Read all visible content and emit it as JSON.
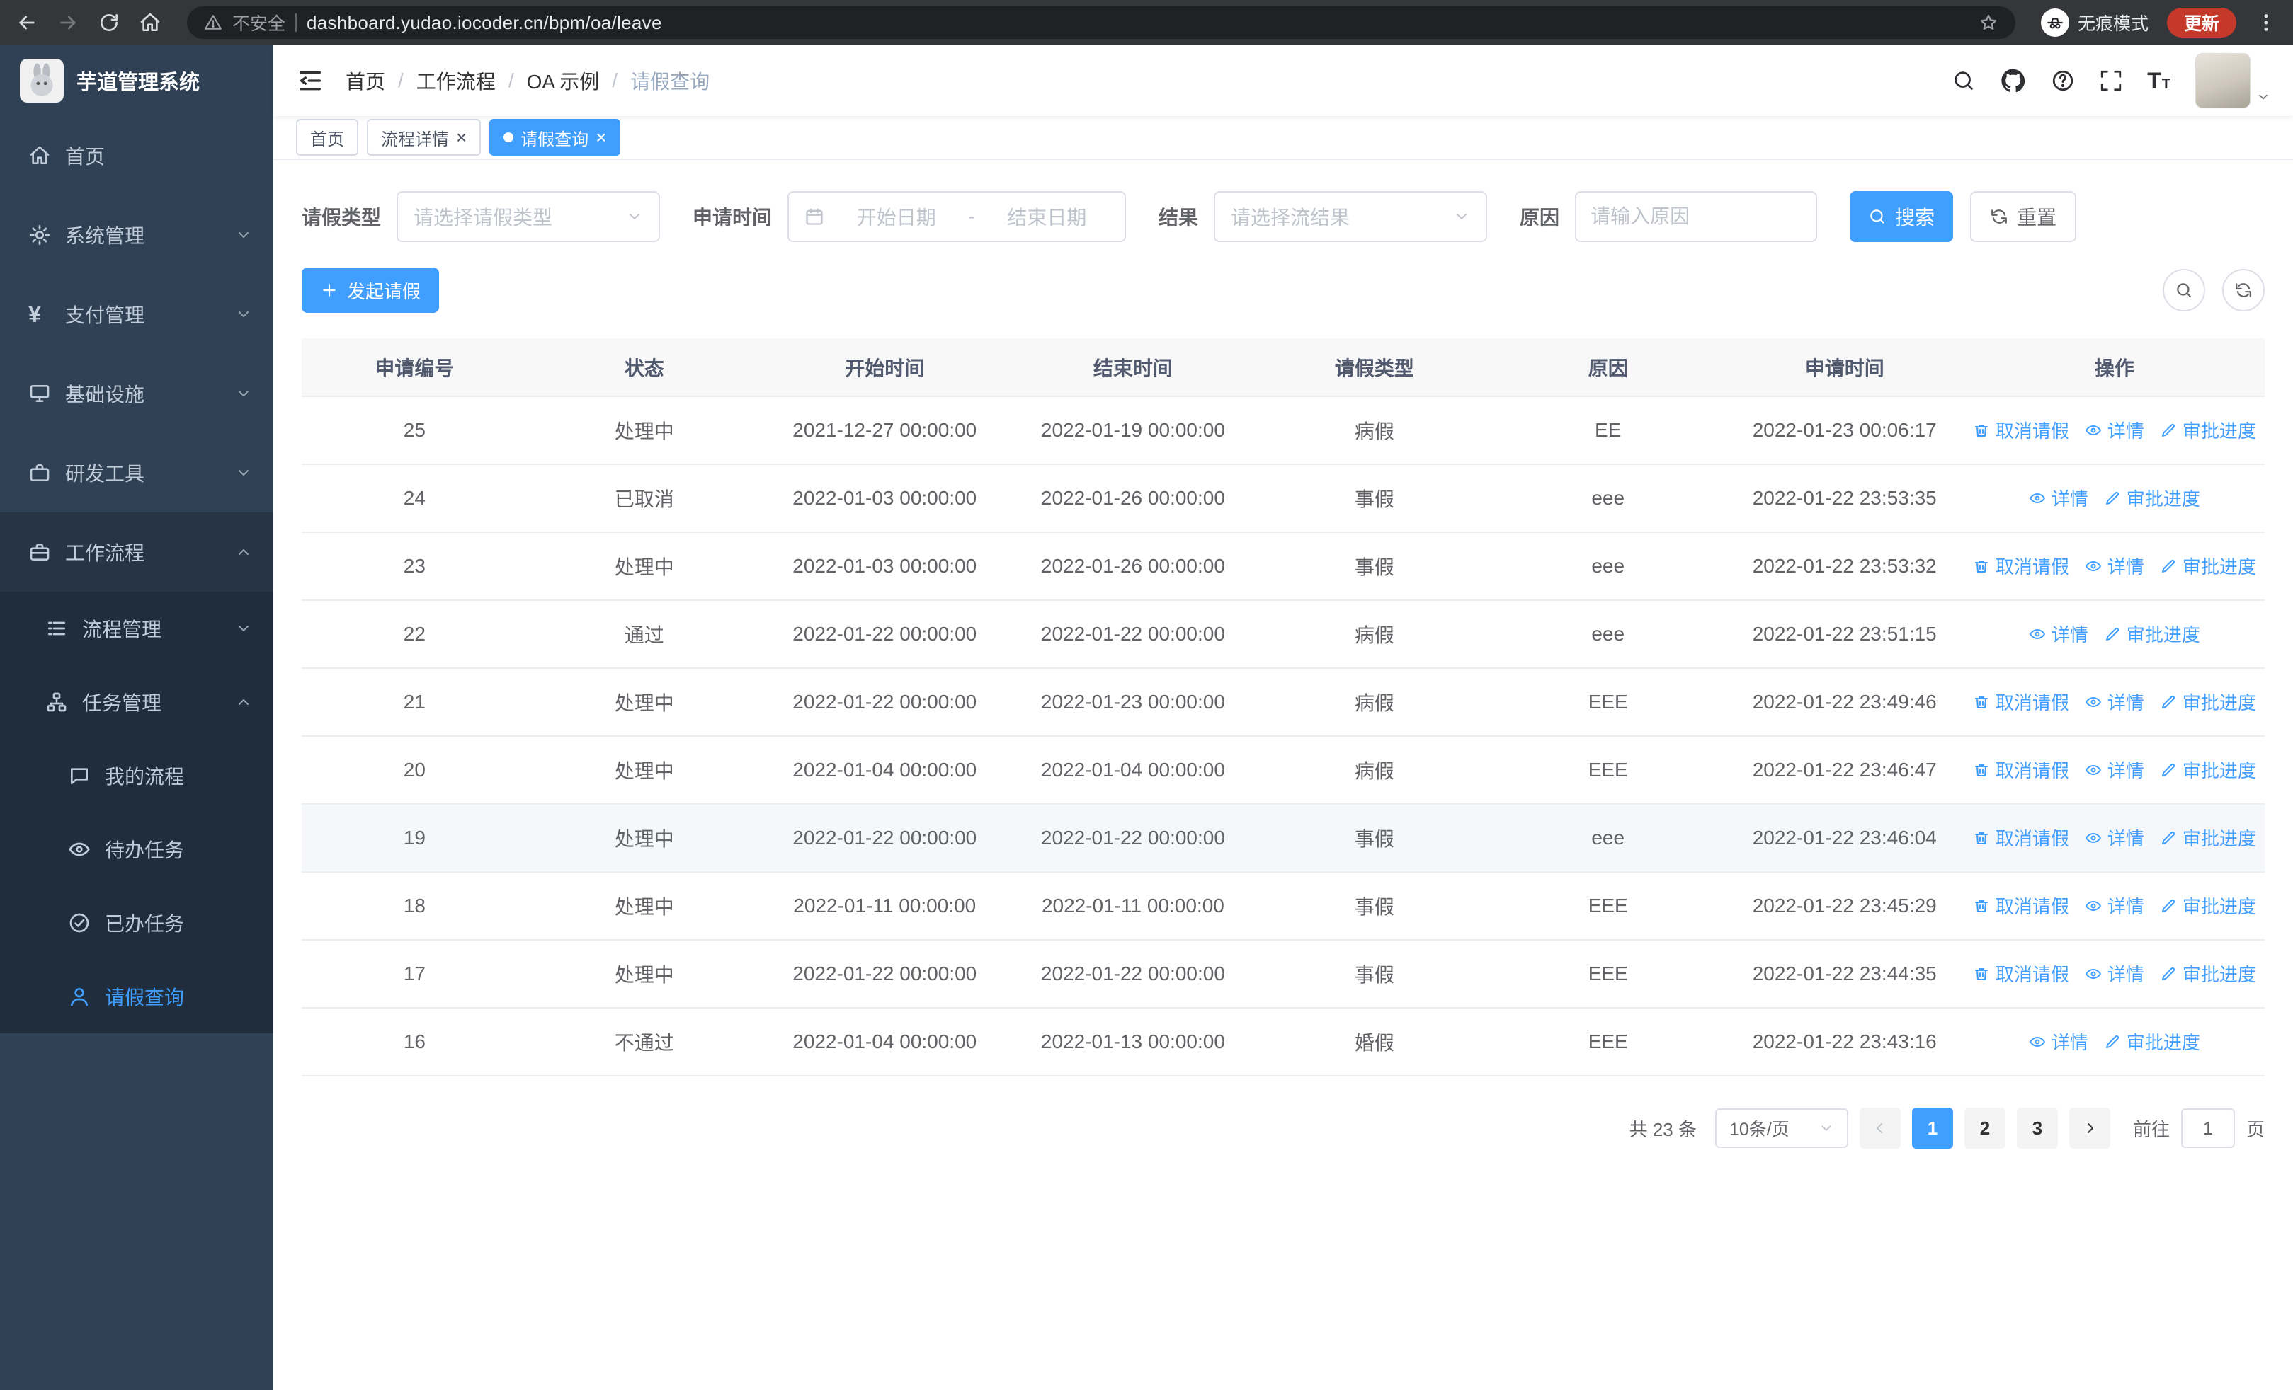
{
  "browser": {
    "security_label": "不安全",
    "url": "dashboard.yudao.iocoder.cn/bpm/oa/leave",
    "incognito_label": "无痕模式",
    "update_label": "更新"
  },
  "sidebar": {
    "app_title": "芋道管理系统",
    "menu": [
      {
        "key": "home",
        "icon": "home",
        "label": "首页"
      },
      {
        "key": "system-mgmt",
        "icon": "gear",
        "label": "系统管理",
        "chevron": "down"
      },
      {
        "key": "payment-mgmt",
        "icon": "yen",
        "label": "支付管理",
        "chevron": "down"
      },
      {
        "key": "infrastructure",
        "icon": "monitor",
        "label": "基础设施",
        "chevron": "down"
      },
      {
        "key": "dev-tools",
        "icon": "briefcase",
        "label": "研发工具",
        "chevron": "down"
      },
      {
        "key": "workflow",
        "icon": "suitcase",
        "label": "工作流程",
        "chevron": "up",
        "expanded": true,
        "children": [
          {
            "key": "process-mgmt",
            "icon": "list",
            "label": "流程管理",
            "chevron": "down"
          },
          {
            "key": "task-mgmt",
            "icon": "tree",
            "label": "任务管理",
            "chevron": "up",
            "expanded": true,
            "children": [
              {
                "key": "my-processes",
                "icon": "chat",
                "label": "我的流程"
              },
              {
                "key": "todo-tasks",
                "icon": "eye",
                "label": "待办任务"
              },
              {
                "key": "done-tasks",
                "icon": "check",
                "label": "已办任务"
              },
              {
                "key": "leave-query",
                "icon": "user",
                "label": "请假查询",
                "active": true
              }
            ]
          }
        ]
      }
    ]
  },
  "navbar": {
    "breadcrumb": [
      "首页",
      "工作流程",
      "OA 示例",
      "请假查询"
    ]
  },
  "tabs": [
    {
      "key": "home",
      "label": "首页"
    },
    {
      "key": "process-detail",
      "label": "流程详情",
      "closable": true
    },
    {
      "key": "leave-query",
      "label": "请假查询",
      "closable": true,
      "active": true
    }
  ],
  "filters": {
    "leave_type_label": "请假类型",
    "leave_type_placeholder": "请选择请假类型",
    "apply_time_label": "申请时间",
    "start_date_placeholder": "开始日期",
    "range_separator": "-",
    "end_date_placeholder": "结束日期",
    "result_label": "结果",
    "result_placeholder": "请选择流结果",
    "reason_label": "原因",
    "reason_placeholder": "请输入原因",
    "search_label": "搜索",
    "reset_label": "重置"
  },
  "toolbar": {
    "create_label": "发起请假"
  },
  "table": {
    "headers": [
      "申请编号",
      "状态",
      "开始时间",
      "结束时间",
      "请假类型",
      "原因",
      "申请时间",
      "操作"
    ],
    "actions": {
      "cancel": "取消请假",
      "detail": "详情",
      "progress": "审批进度"
    },
    "rows": [
      {
        "id": "25",
        "status": "处理中",
        "start": "2021-12-27 00:00:00",
        "end": "2022-01-19 00:00:00",
        "type": "病假",
        "reason": "EE",
        "applied": "2022-01-23 00:06:17",
        "cancellable": true
      },
      {
        "id": "24",
        "status": "已取消",
        "start": "2022-01-03 00:00:00",
        "end": "2022-01-26 00:00:00",
        "type": "事假",
        "reason": "eee",
        "applied": "2022-01-22 23:53:35",
        "cancellable": false
      },
      {
        "id": "23",
        "status": "处理中",
        "start": "2022-01-03 00:00:00",
        "end": "2022-01-26 00:00:00",
        "type": "事假",
        "reason": "eee",
        "applied": "2022-01-22 23:53:32",
        "cancellable": true
      },
      {
        "id": "22",
        "status": "通过",
        "start": "2022-01-22 00:00:00",
        "end": "2022-01-22 00:00:00",
        "type": "病假",
        "reason": "eee",
        "applied": "2022-01-22 23:51:15",
        "cancellable": false
      },
      {
        "id": "21",
        "status": "处理中",
        "start": "2022-01-22 00:00:00",
        "end": "2022-01-23 00:00:00",
        "type": "病假",
        "reason": "EEE",
        "applied": "2022-01-22 23:49:46",
        "cancellable": true
      },
      {
        "id": "20",
        "status": "处理中",
        "start": "2022-01-04 00:00:00",
        "end": "2022-01-04 00:00:00",
        "type": "病假",
        "reason": "EEE",
        "applied": "2022-01-22 23:46:47",
        "cancellable": true
      },
      {
        "id": "19",
        "status": "处理中",
        "start": "2022-01-22 00:00:00",
        "end": "2022-01-22 00:00:00",
        "type": "事假",
        "reason": "eee",
        "applied": "2022-01-22 23:46:04",
        "cancellable": true,
        "highlight": true
      },
      {
        "id": "18",
        "status": "处理中",
        "start": "2022-01-11 00:00:00",
        "end": "2022-01-11 00:00:00",
        "type": "事假",
        "reason": "EEE",
        "applied": "2022-01-22 23:45:29",
        "cancellable": true
      },
      {
        "id": "17",
        "status": "处理中",
        "start": "2022-01-22 00:00:00",
        "end": "2022-01-22 00:00:00",
        "type": "事假",
        "reason": "EEE",
        "applied": "2022-01-22 23:44:35",
        "cancellable": true
      },
      {
        "id": "16",
        "status": "不通过",
        "start": "2022-01-04 00:00:00",
        "end": "2022-01-13 00:00:00",
        "type": "婚假",
        "reason": "EEE",
        "applied": "2022-01-22 23:43:16",
        "cancellable": false
      }
    ]
  },
  "pagination": {
    "total": "共 23 条",
    "page_size": "10条/页",
    "pages": [
      "1",
      "2",
      "3"
    ],
    "active_page": "1",
    "goto_label": "前往",
    "goto_value": "1",
    "page_label": "页"
  },
  "colors": {
    "primary": "#409eff",
    "sidebar_bg": "#304156",
    "submenu_bg": "#1f2d3d"
  }
}
